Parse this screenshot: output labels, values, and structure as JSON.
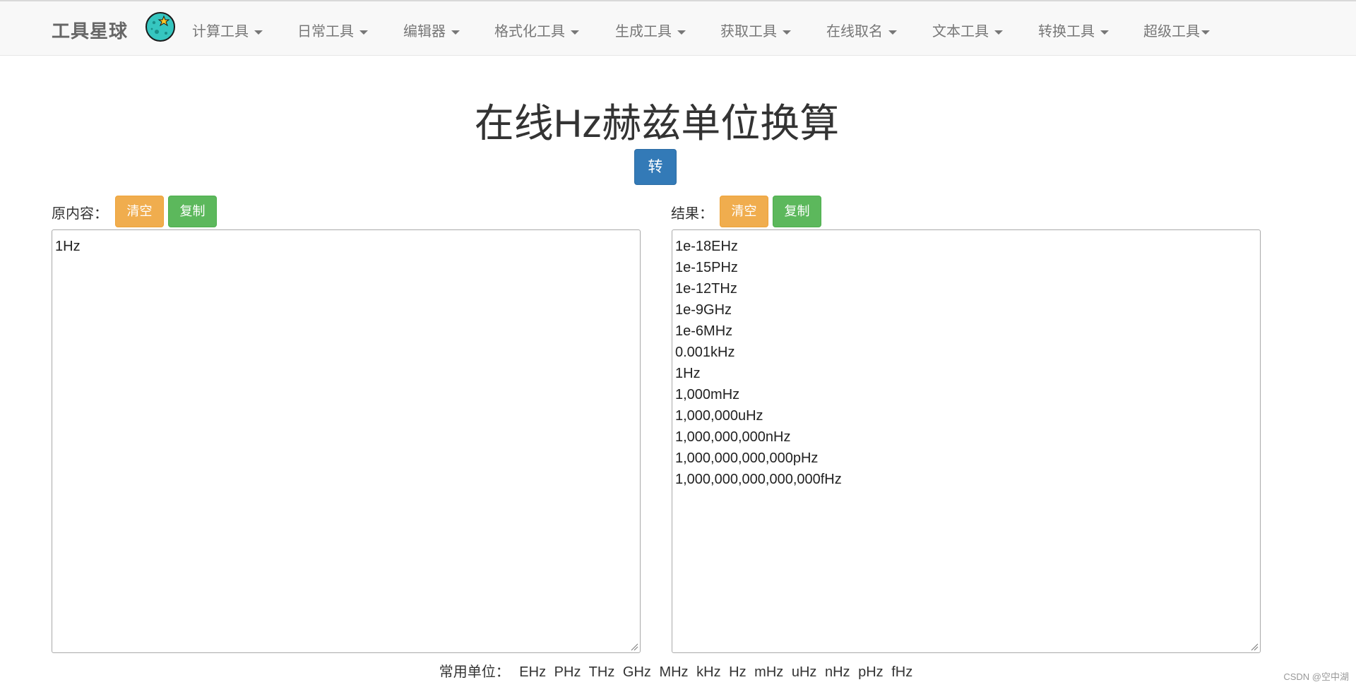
{
  "brand": "工具星球",
  "nav": [
    "计算工具",
    "日常工具",
    "编辑器",
    "格式化工具",
    "生成工具",
    "获取工具",
    "在线取名",
    "文本工具",
    "转换工具",
    "超级工具"
  ],
  "page_title": "在线Hz赫兹单位换算",
  "convert_button": "转",
  "left": {
    "label": "原内容：",
    "clear": "清空",
    "copy": "复制",
    "content": "1Hz"
  },
  "right": {
    "label": "结果：",
    "clear": "清空",
    "copy": "复制",
    "lines": [
      "1e-18EHz",
      "1e-15PHz",
      "1e-12THz",
      "1e-9GHz",
      "1e-6MHz",
      "0.001kHz",
      "1Hz",
      "1,000mHz",
      "1,000,000uHz",
      "1,000,000,000nHz",
      "1,000,000,000,000pHz",
      "1,000,000,000,000,000fHz"
    ]
  },
  "units_label": "常用单位：",
  "units": [
    "EHz",
    "PHz",
    "THz",
    "GHz",
    "MHz",
    "kHz",
    "Hz",
    "mHz",
    "uHz",
    "nHz",
    "pHz",
    "fHz"
  ],
  "watermark": "CSDN @空中湖"
}
